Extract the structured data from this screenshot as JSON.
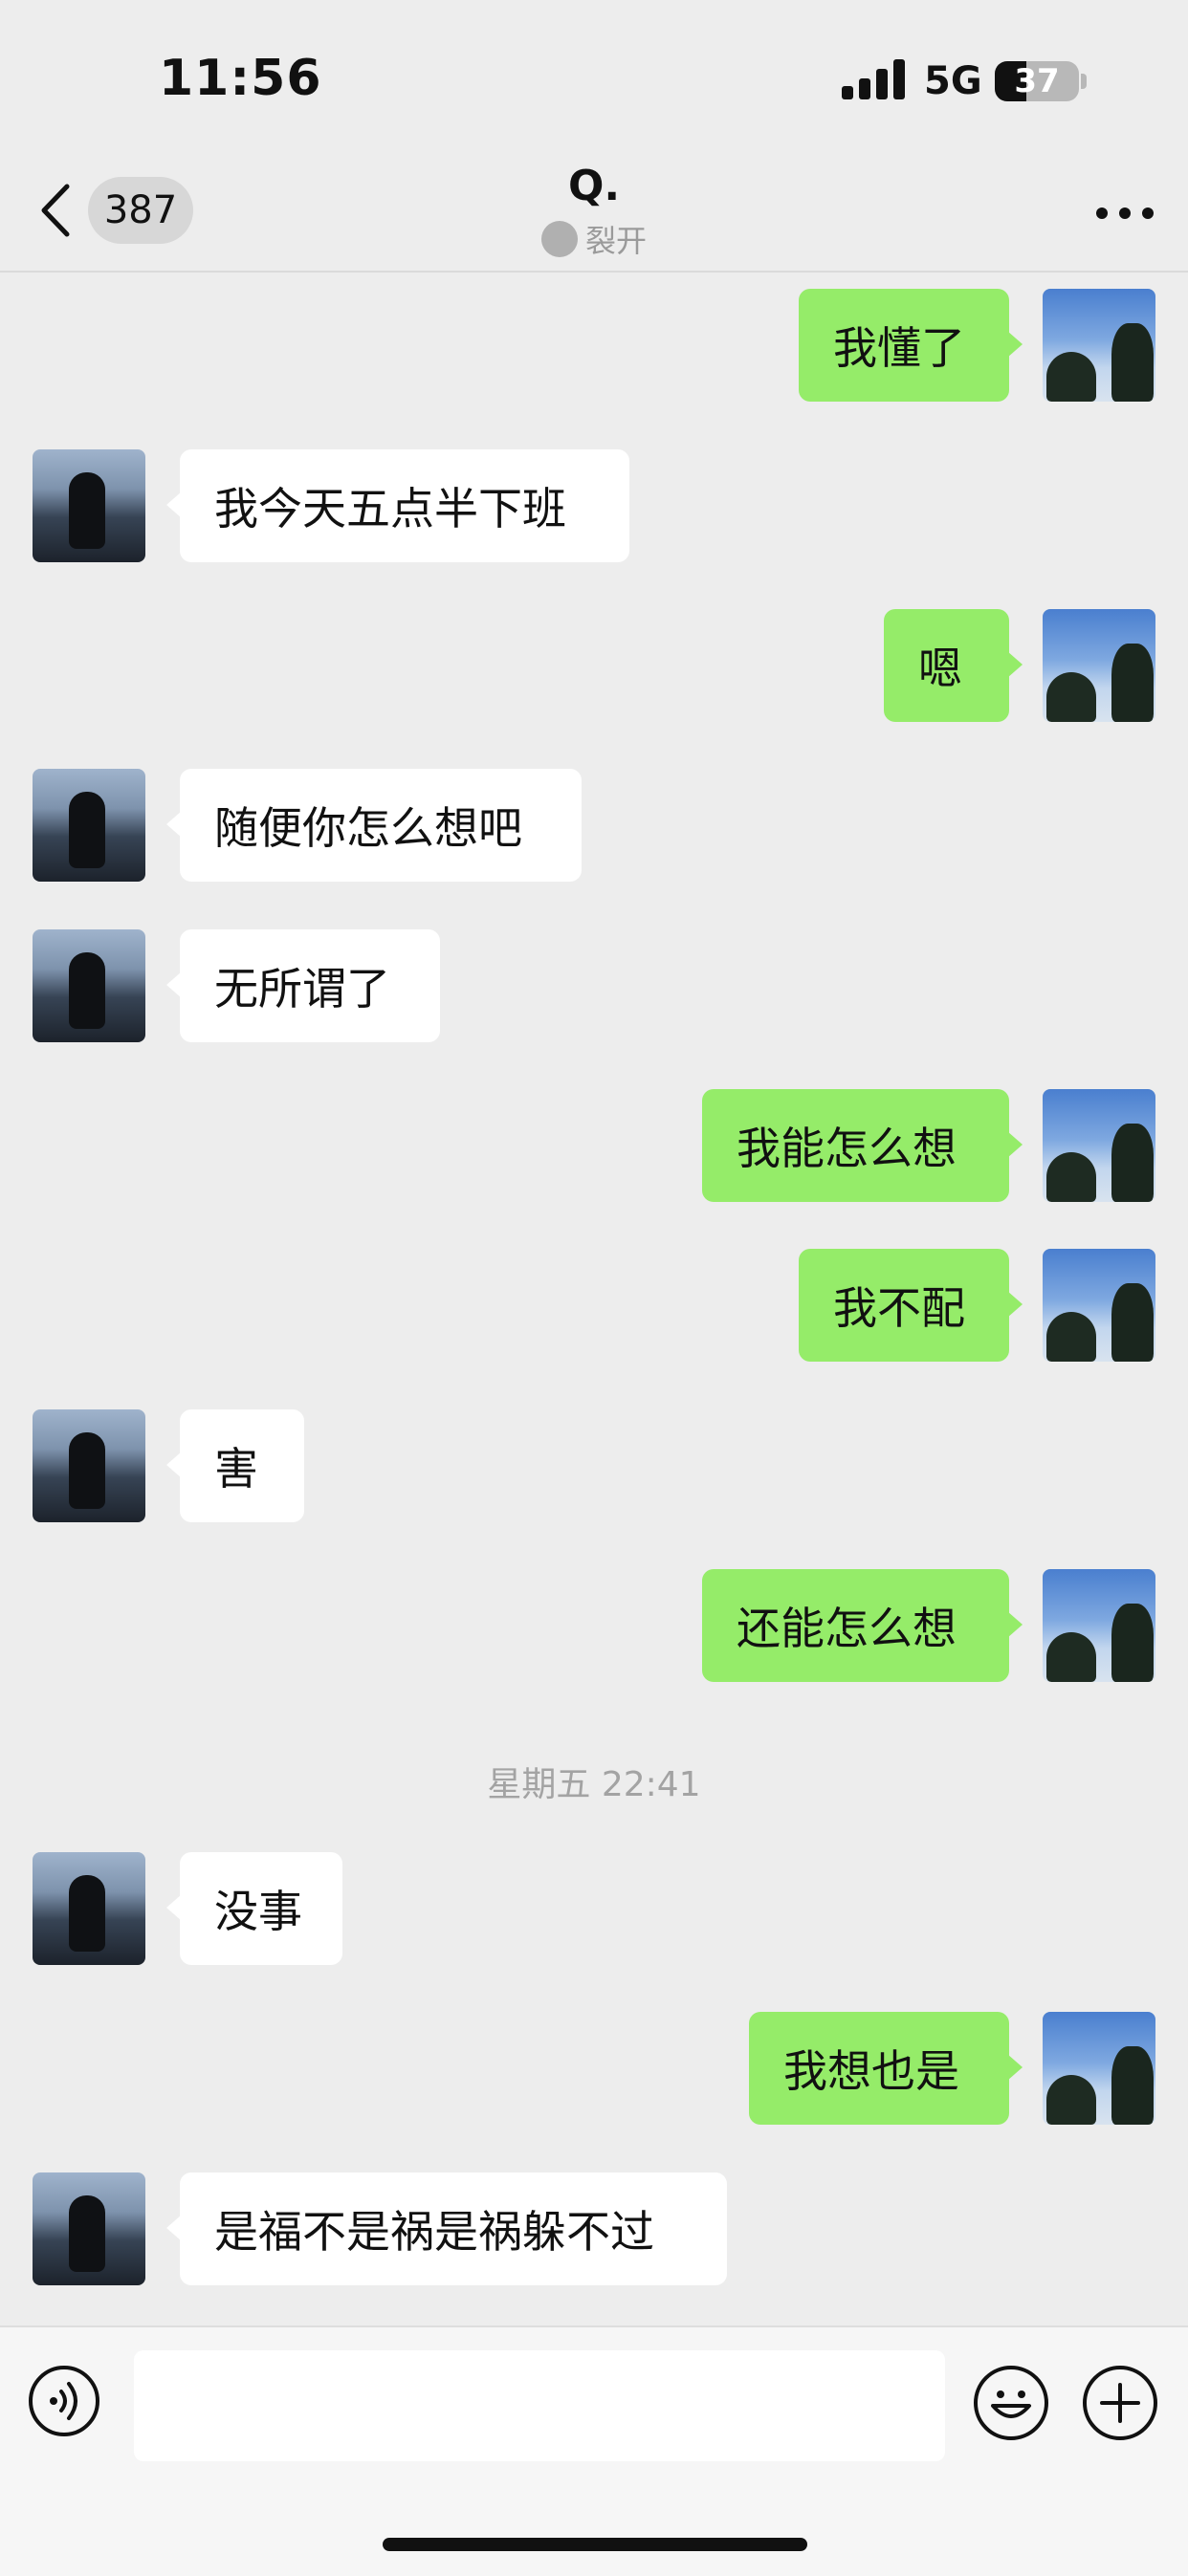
{
  "status_bar": {
    "time": "11:56",
    "network": "5G",
    "battery": "37"
  },
  "header": {
    "back_badge": "387",
    "title": "Q.",
    "subtitle": "裂开"
  },
  "messages": [
    {
      "side": "me",
      "text": "我懂了"
    },
    {
      "side": "them",
      "text": "我今天五点半下班"
    },
    {
      "side": "me",
      "text": "嗯"
    },
    {
      "side": "them",
      "text": "随便你怎么想吧"
    },
    {
      "side": "them",
      "text": "无所谓了"
    },
    {
      "side": "me",
      "text": "我能怎么想"
    },
    {
      "side": "me",
      "text": "我不配"
    },
    {
      "side": "them",
      "text": "害"
    },
    {
      "side": "me",
      "text": "还能怎么想"
    },
    {
      "side": "them",
      "text": "没事"
    },
    {
      "side": "me",
      "text": "我想也是"
    },
    {
      "side": "them",
      "text": "是福不是祸是祸躲不过"
    }
  ],
  "timestamp": "星期五 22:41",
  "input": {
    "placeholder": ""
  }
}
